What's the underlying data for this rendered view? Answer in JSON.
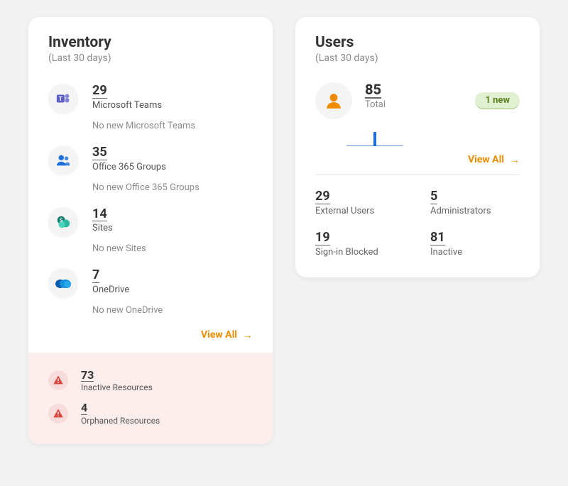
{
  "inventory": {
    "title": "Inventory",
    "subtitle": "(Last 30 days)",
    "items": [
      {
        "count": "29",
        "label": "Microsoft Teams",
        "nonew": "No new Microsoft Teams"
      },
      {
        "count": "35",
        "label": "Office 365 Groups",
        "nonew": "No new Office 365 Groups"
      },
      {
        "count": "14",
        "label": "Sites",
        "nonew": "No new Sites"
      },
      {
        "count": "7",
        "label": "OneDrive",
        "nonew": "No new OneDrive"
      }
    ],
    "view_all": "View All",
    "alerts": [
      {
        "count": "73",
        "label": "Inactive Resources"
      },
      {
        "count": "4",
        "label": "Orphaned Resources"
      }
    ]
  },
  "users": {
    "title": "Users",
    "subtitle": "(Last 30 days)",
    "total_count": "85",
    "total_label": "Total",
    "new_badge": "1 new",
    "view_all": "View All",
    "stats": [
      {
        "count": "29",
        "label": "External Users"
      },
      {
        "count": "5",
        "label": "Administrators"
      },
      {
        "count": "19",
        "label": "Sign-in Blocked"
      },
      {
        "count": "81",
        "label": "Inactive"
      }
    ]
  }
}
